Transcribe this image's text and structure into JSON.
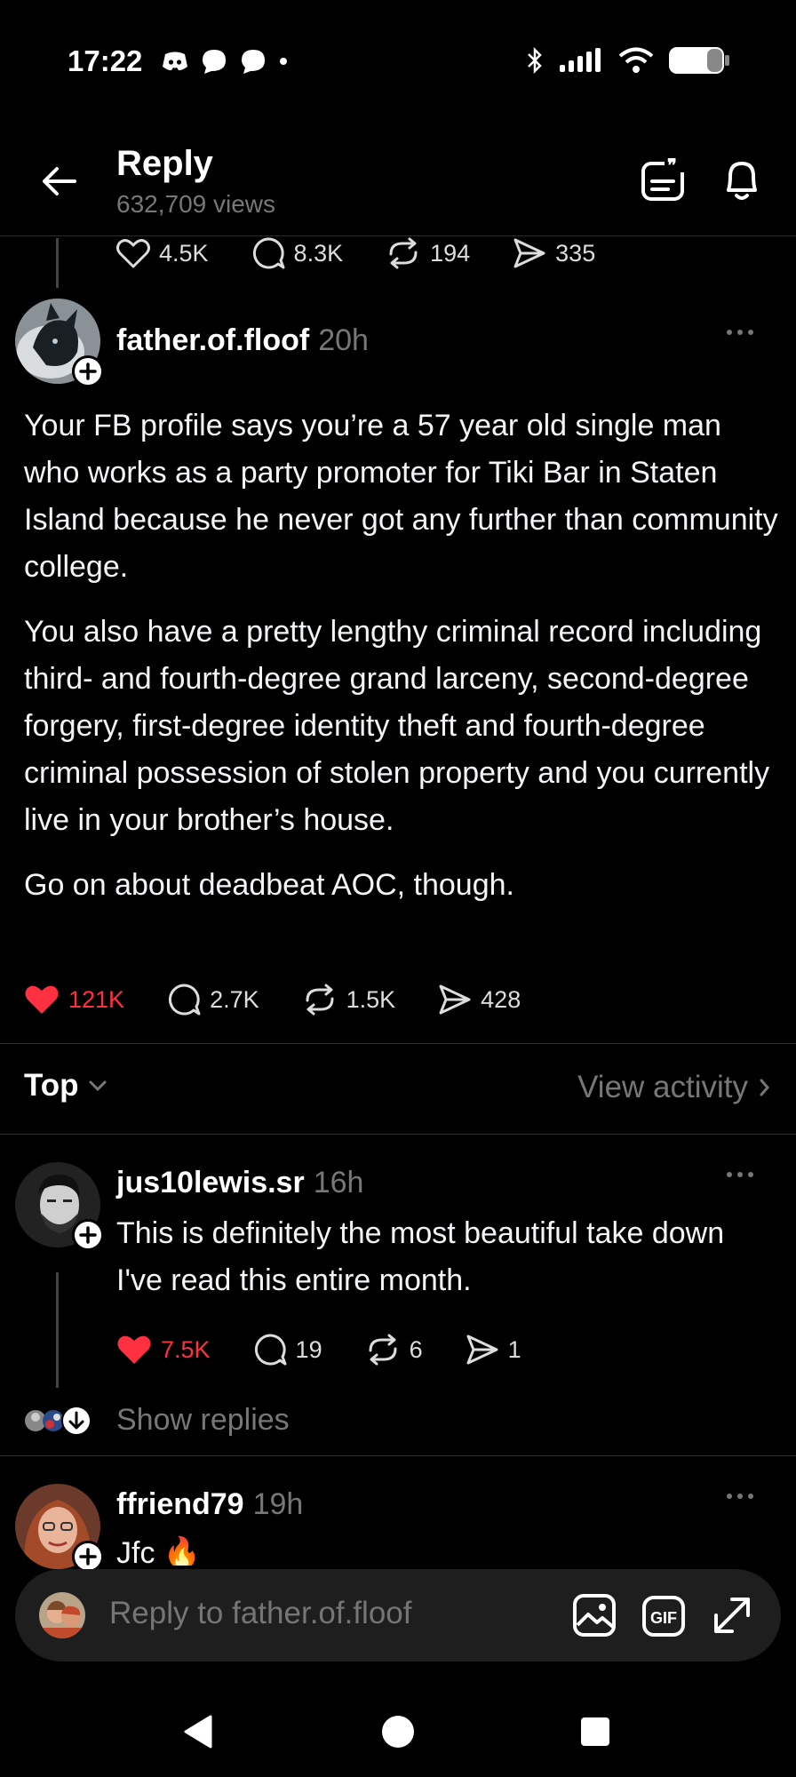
{
  "status_bar": {
    "time": "17:22"
  },
  "header": {
    "title": "Reply",
    "views": "632,709 views"
  },
  "parent_actions": {
    "likes": "4.5K",
    "replies": "8.3K",
    "reposts": "194",
    "shares": "335"
  },
  "main_post": {
    "username": "father.of.floof",
    "time": "20h",
    "paragraphs": [
      "Your FB profile says you’re a 57 year old single man who works as a party promoter for Tiki Bar in Staten Island because he never got any further than community college.",
      "You also have a pretty lengthy criminal record including third- and fourth-degree grand larceny, second-degree forgery, first-degree identity theft and fourth-degree criminal possession of stolen property and you currently live in your brother’s house.",
      "Go on about deadbeat AOC, though."
    ],
    "likes": "121K",
    "replies": "2.7K",
    "reposts": "1.5K",
    "shares": "428"
  },
  "sort_bar": {
    "sort_label": "Top",
    "view_activity": "View activity"
  },
  "comments": [
    {
      "username": "jus10lewis.sr",
      "time": "16h",
      "text": "This is definitely the most beautiful take down I've read this entire month.",
      "likes": "7.5K",
      "replies": "19",
      "reposts": "6",
      "shares": "1",
      "show_replies": "Show replies"
    },
    {
      "username": "ffriend79",
      "time": "19h",
      "text": "Jfc 🔥"
    }
  ],
  "reply_bar": {
    "placeholder": "Reply to father.of.floof"
  },
  "colors": {
    "background": "#000000",
    "like_red": "#ff3040",
    "muted_gray": "#777777"
  }
}
